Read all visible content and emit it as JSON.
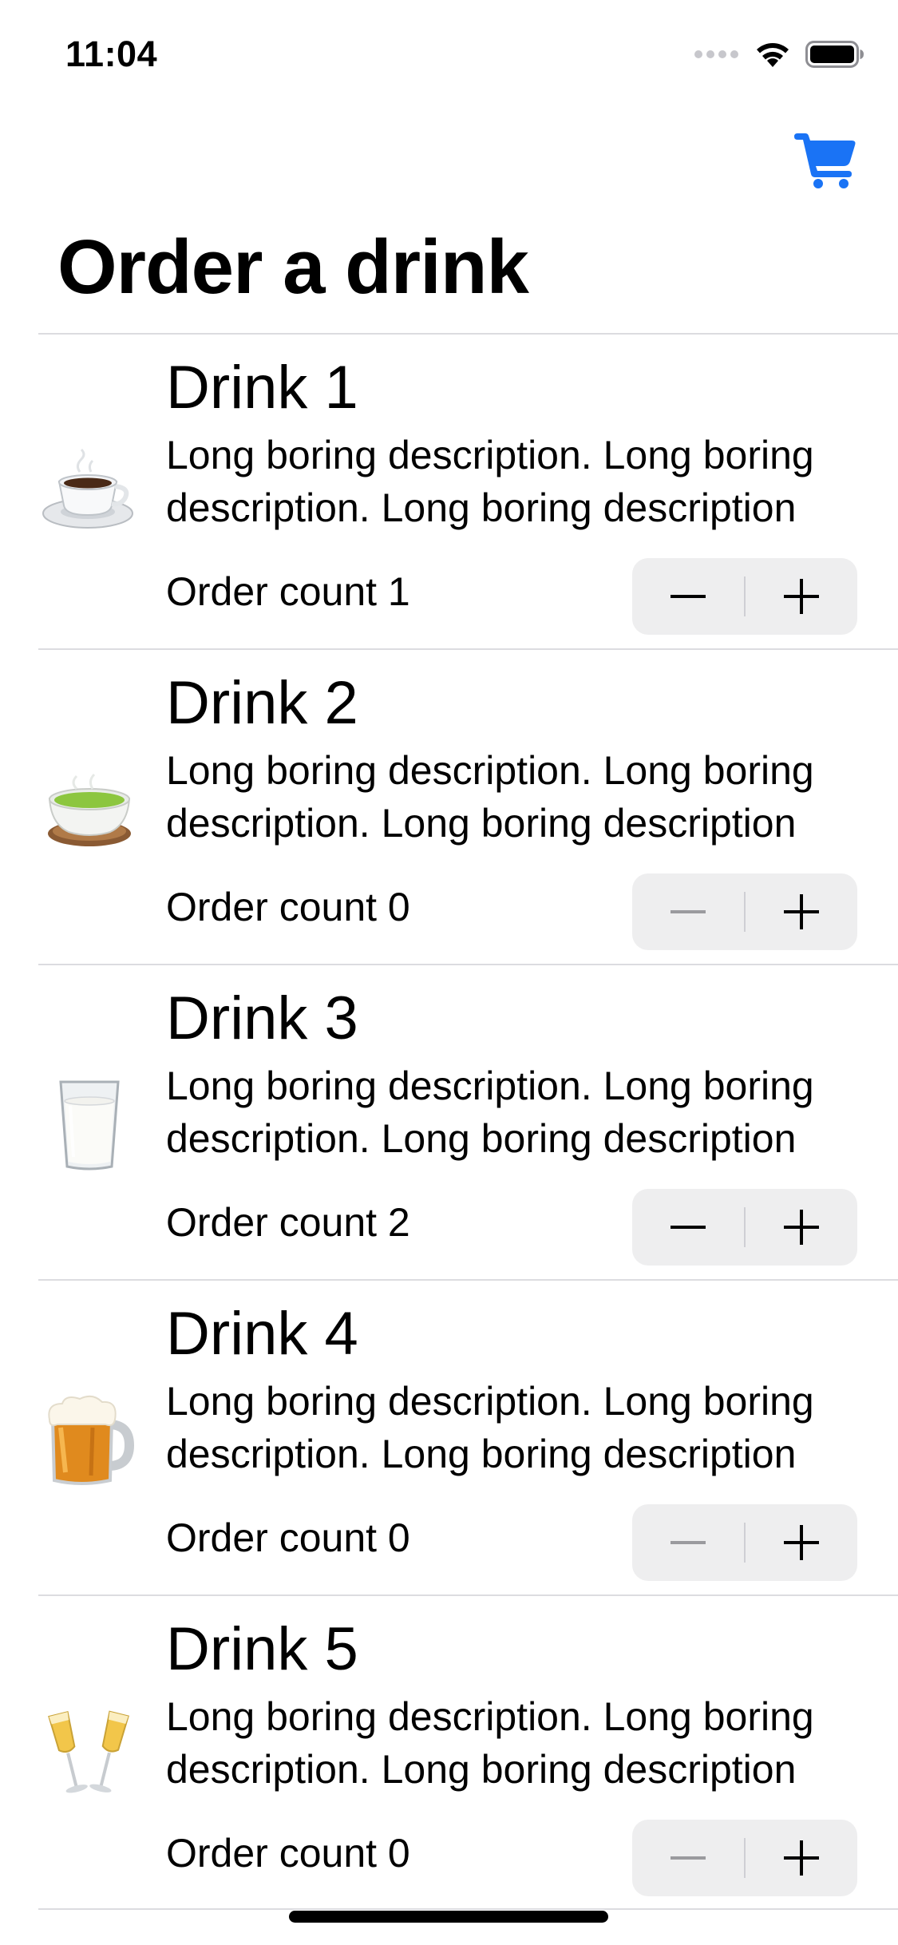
{
  "status_bar": {
    "time": "11:04",
    "icons": [
      "signal-dots",
      "wifi-icon",
      "battery-icon"
    ]
  },
  "nav": {
    "cart_icon": "cart-icon",
    "accent_color": "#1a73f5",
    "title": "Order a drink"
  },
  "drinks": [
    {
      "icon": "coffee-icon",
      "name": "Drink 1",
      "description": "Long boring description. Long boring description. Long boring description",
      "order_count": "Order count 1",
      "decrement_enabled": true
    },
    {
      "icon": "green-tea-icon",
      "name": "Drink 2",
      "description": "Long boring description. Long boring description. Long boring description",
      "order_count": "Order count 0",
      "decrement_enabled": false
    },
    {
      "icon": "milk-glass-icon",
      "name": "Drink 3",
      "description": "Long boring description. Long boring description. Long boring description",
      "order_count": "Order count 2",
      "decrement_enabled": true
    },
    {
      "icon": "beer-mug-icon",
      "name": "Drink 4",
      "description": "Long boring description. Long boring description. Long boring description",
      "order_count": "Order count 0",
      "decrement_enabled": false
    },
    {
      "icon": "champagne-glasses-icon",
      "name": "Drink 5",
      "description": "Long boring description. Long boring description. Long boring description",
      "order_count": "Order count 0",
      "decrement_enabled": false
    }
  ]
}
